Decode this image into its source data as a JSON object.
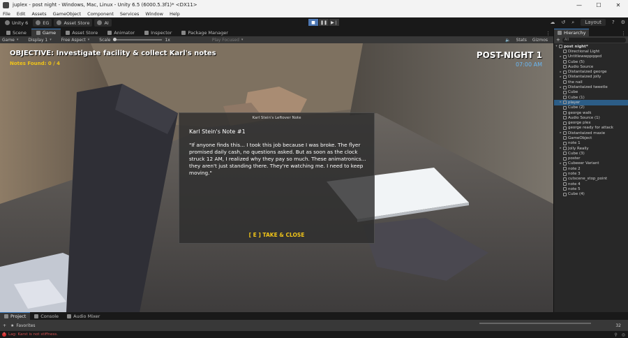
{
  "window": {
    "title": "juplex - post night - Windows, Mac, Linux - Unity 6.5 (6000.5.3f1)* <DX11>",
    "minimize": "—",
    "maximize": "☐",
    "close": "✕"
  },
  "menu": [
    "File",
    "Edit",
    "Assets",
    "GameObject",
    "Component",
    "Services",
    "Window",
    "Help"
  ],
  "toolbar": {
    "unity_label": "Unity 6",
    "account": "EG",
    "asset_store": "Asset Store",
    "ai": "AI",
    "layout": "Layout"
  },
  "tabs": [
    {
      "label": "Scene"
    },
    {
      "label": "Game"
    },
    {
      "label": "Asset Store"
    },
    {
      "label": "Animator"
    },
    {
      "label": "Inspector"
    },
    {
      "label": "Package Manager"
    }
  ],
  "game_toolbar": {
    "mode": "Game",
    "display": "Display 1",
    "aspect": "Free Aspect",
    "scale_label": "Scale",
    "scale_value": "1x",
    "play_focused": "Play Focused",
    "stats": "Stats",
    "gizmos": "Gizmos"
  },
  "hud": {
    "objective": "OBJECTIVE: Investigate facility & collect Karl's notes",
    "notes_found": "Notes Found: 0 / 4",
    "night": "POST-NIGHT 1",
    "time": "07:00 AM"
  },
  "note": {
    "header": "Karl Stein's Leftover Note",
    "title": "Karl Stein's Note #1",
    "body": "\"If anyone finds this... I took this job because I was broke. The flyer promised daily cash, no questions asked. But as soon as the clock struck 12 AM, I realized why they pay so much. These animatronics... they aren't just standing there. They're watching me. I need to keep moving.\"",
    "action": "[ E ] TAKE & CLOSE"
  },
  "hierarchy": {
    "tab": "Hierarchy",
    "search_placeholder": "All",
    "scene": "post night*",
    "items": [
      {
        "label": "Directional Light",
        "arrow": "",
        "selected": false
      },
      {
        "label": "Untitlewwppqqed",
        "arrow": "▸",
        "selected": false
      },
      {
        "label": "Cube (5)",
        "arrow": "",
        "selected": false
      },
      {
        "label": "Audio Source",
        "arrow": "",
        "selected": false
      },
      {
        "label": "Distantaized george",
        "arrow": "▸",
        "selected": false
      },
      {
        "label": "Distantaized jolly",
        "arrow": "▸",
        "selected": false
      },
      {
        "label": "the nail",
        "arrow": "",
        "selected": false
      },
      {
        "label": "Distantaized tweetle",
        "arrow": "▸",
        "selected": false
      },
      {
        "label": "Cube",
        "arrow": "",
        "selected": false
      },
      {
        "label": "Cube (1)",
        "arrow": "",
        "selected": false
      },
      {
        "label": "player",
        "arrow": "▸",
        "selected": true
      },
      {
        "label": "Cube (2)",
        "arrow": "",
        "selected": false
      },
      {
        "label": "george walk",
        "arrow": "",
        "selected": false
      },
      {
        "label": "Audio Source (1)",
        "arrow": "",
        "selected": false
      },
      {
        "label": "george plex",
        "arrow": "",
        "selected": false
      },
      {
        "label": "george ready for attack",
        "arrow": "",
        "selected": false
      },
      {
        "label": "Distantaized maxie",
        "arrow": "▸",
        "selected": false
      },
      {
        "label": "GameObject",
        "arrow": "",
        "selected": false
      },
      {
        "label": "note 1",
        "arrow": "",
        "selected": false
      },
      {
        "label": "Jolly Really",
        "arrow": "▸",
        "selected": false
      },
      {
        "label": "Cube (3)",
        "arrow": "",
        "selected": false
      },
      {
        "label": "poster",
        "arrow": "",
        "selected": false
      },
      {
        "label": "Cubeeer Variant",
        "arrow": "▸",
        "selected": false
      },
      {
        "label": "note 2",
        "arrow": "",
        "selected": false
      },
      {
        "label": "note 3",
        "arrow": "",
        "selected": false
      },
      {
        "label": "cutscene_stop_point",
        "arrow": "",
        "selected": false
      },
      {
        "label": "note 4",
        "arrow": "",
        "selected": false
      },
      {
        "label": "note 5",
        "arrow": "",
        "selected": false
      },
      {
        "label": "Cube (4)",
        "arrow": "",
        "selected": false
      }
    ]
  },
  "bottom": {
    "tabs": [
      "Project",
      "Console",
      "Audio Mixer"
    ],
    "favorites": "Favorites",
    "count": "32"
  },
  "status": {
    "message": "Lag: Karst is not stiffness."
  }
}
